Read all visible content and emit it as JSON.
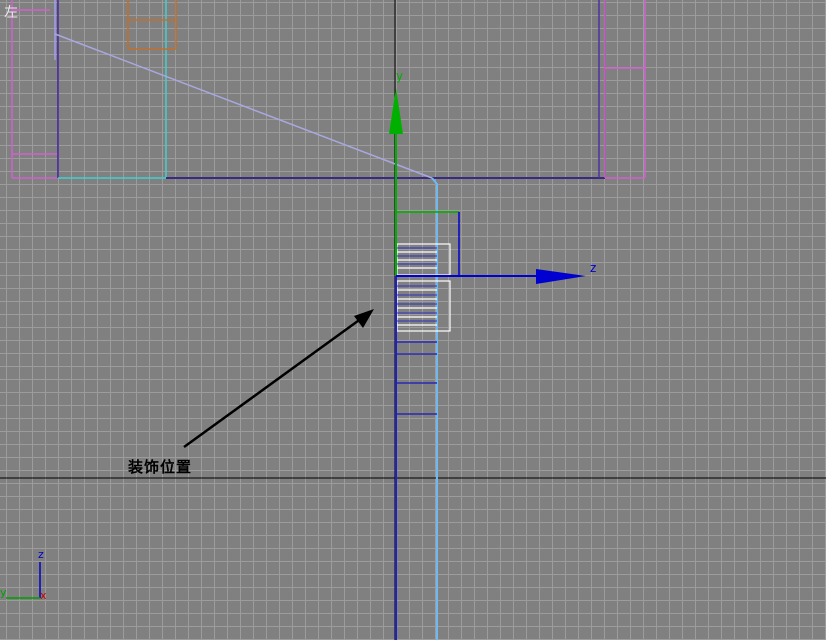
{
  "viewport": {
    "label": "左",
    "grid_color": "#9c9c9c",
    "background_color": "#808080"
  },
  "annotation": {
    "text": "装饰位置",
    "arrow_color": "#000000"
  },
  "gizmo": {
    "y_label": "y",
    "z_label": "z",
    "y_color": "#00a000",
    "z_color": "#0000c8"
  },
  "axis_tripod": {
    "z_label": "z",
    "y_label": "y",
    "x_label": "x",
    "z_color": "#0000c8",
    "y_color": "#00a000",
    "x_color": "#c80000"
  }
}
